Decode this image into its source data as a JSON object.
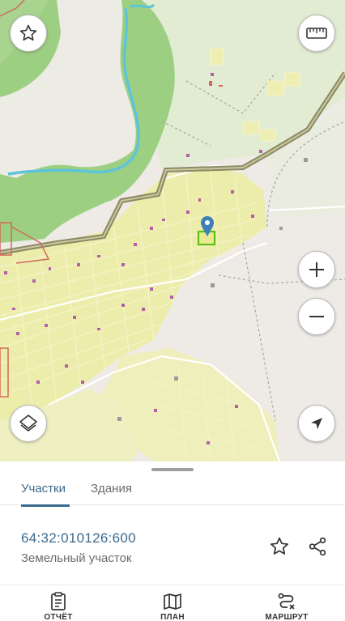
{
  "map": {
    "controls": {
      "favorite": "star-icon",
      "ruler": "ruler-icon",
      "zoom_in": "plus-icon",
      "zoom_out": "minus-icon",
      "layers": "layers-icon",
      "locate": "navigation-arrow-icon"
    },
    "colors": {
      "forest": "#9ccf80",
      "settlement": "#eaeaa6",
      "river": "#57c3d6",
      "boundary": "#8a8a63",
      "selected_parcel": "#6cc21e",
      "marker": "#3f7fb8"
    }
  },
  "sheet": {
    "tabs": [
      {
        "label": "Участки",
        "active": true
      },
      {
        "label": "Здания",
        "active": false
      }
    ],
    "parcel": {
      "number": "64:32:010126:600",
      "type": "Земельный участок"
    },
    "actions": [
      "star-icon",
      "share-icon"
    ]
  },
  "bottom_nav": [
    {
      "label": "ОТЧЁТ",
      "icon": "report-icon"
    },
    {
      "label": "ПЛАН",
      "icon": "map-plan-icon"
    },
    {
      "label": "МАРШРУТ",
      "icon": "route-icon"
    }
  ]
}
